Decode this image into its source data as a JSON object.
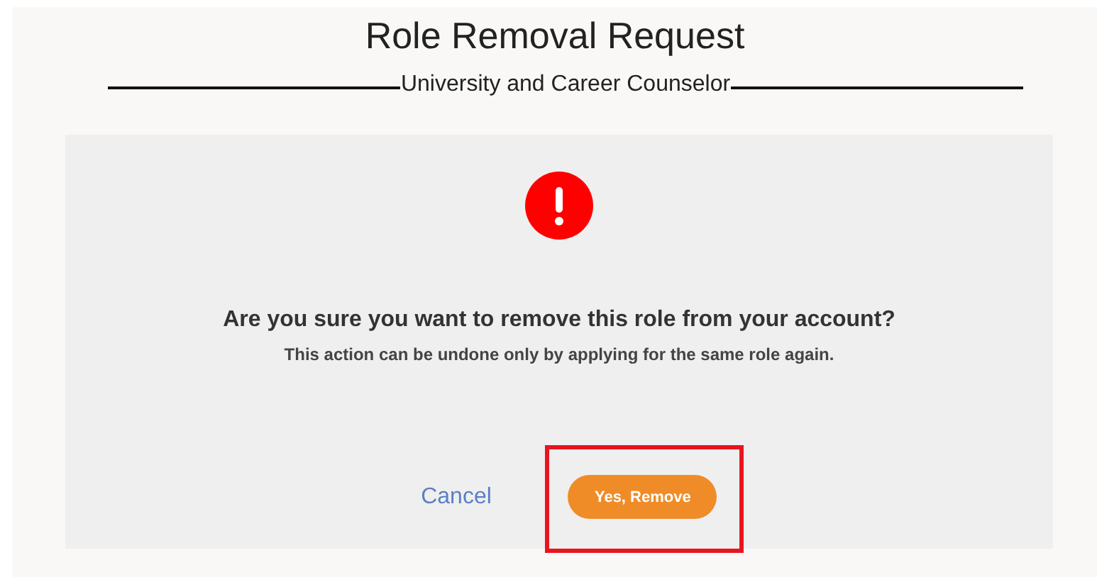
{
  "header": {
    "title": "Role Removal Request",
    "subtitle": "University and Career Counselor"
  },
  "dialog": {
    "question": "Are you sure you want to remove this role from your account?",
    "note": "This action can be undone only by applying for the same role again.",
    "buttons": [
      {
        "label": "Cancel",
        "kind": "link",
        "highlighted": false
      },
      {
        "label": "Yes, Remove",
        "kind": "primary",
        "highlighted": true
      }
    ]
  }
}
